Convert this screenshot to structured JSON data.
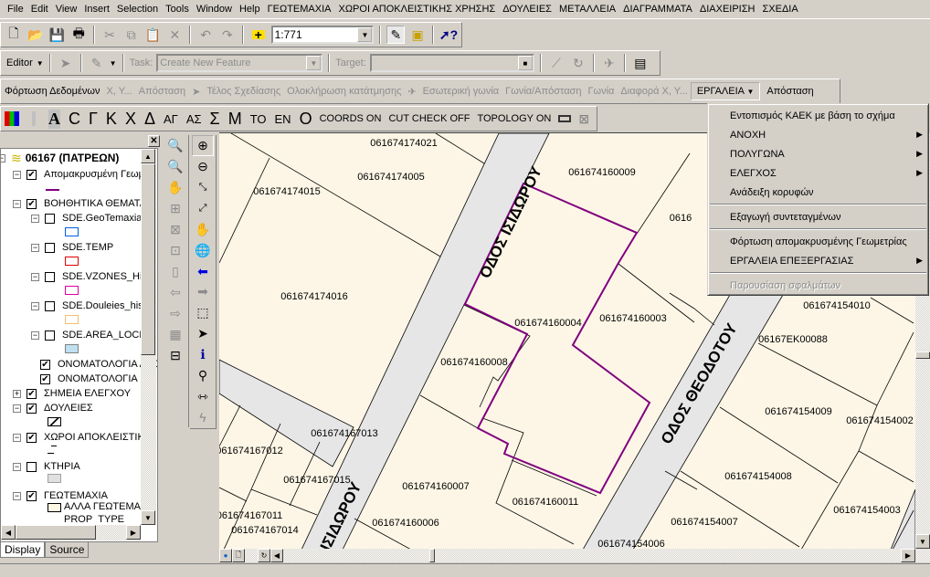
{
  "menubar": [
    "File",
    "Edit",
    "View",
    "Insert",
    "Selection",
    "Tools",
    "Window",
    "Help",
    "ΓΕΩΤΕΜΑΧΙΑ",
    "ΧΩΡΟΙ ΑΠΟΚΛΕΙΣΤΙΚΗΣ ΧΡΗΣΗΣ",
    "ΔΟΥΛΕΙΕΣ",
    "ΜΕΤΑΛΛΕΙΑ",
    "ΔΙΑΓΡΑΜΜΑΤΑ",
    "ΔΙΑΧΕΙΡΙΣΗ",
    "ΣΧΕΔΙΑ"
  ],
  "standard": {
    "scale": "1:771",
    "icons": [
      "new-document",
      "open-folder",
      "save",
      "print",
      "cut",
      "copy",
      "paste",
      "delete",
      "undo",
      "redo",
      "add-data",
      "editor-toolbar",
      "arccatalog",
      "whats-this"
    ]
  },
  "editor": {
    "label": "Editor",
    "task_label": "Task:",
    "task_value": "Create New Feature",
    "target_label": "Target:",
    "target_value": ""
  },
  "custom": {
    "items": [
      "Φόρτωση Δεδομένων",
      "X, Y...",
      "Απόσταση",
      "Τέλος Σχεδίασης",
      "Ολοκλήρωση κατάτμησης",
      "Εσωτερική γωνία",
      "Γωνία/Απόσταση",
      "Γωνία",
      "Διαφορά X, Y...",
      "ΕΡΓΑΛΕΙΑ",
      "Απόσταση"
    ]
  },
  "letters": {
    "items": [
      "A",
      "C",
      "Γ",
      "Κ",
      "Χ",
      "Δ",
      "ΑΓ",
      "ΑΣ",
      "Σ",
      "Μ",
      "ΤΟ",
      "ΕΝ",
      "Ο"
    ],
    "coords": "COORDS ON",
    "cut": "CUT CHECK OFF",
    "topology": "TOPOLOGY ON"
  },
  "toc": {
    "root": "06167 (ΠΑΤΡΕΩΝ)",
    "layers": [
      "Απομακρυσμένη Γεωμ",
      "ΒΟΗΘΗΤΙΚΑ ΘΕΜΑΤΑ",
      "SDE.GeoTemaxia",
      "SDE.TEMP",
      "SDE.VZONES_His",
      "SDE.Douleies_his",
      "SDE.AREA_LOCK",
      "ΟΝΟΜΑΤΟΛΟΓΙΑ ΔΡΟ",
      "ΟΝΟΜΑΤΟΛΟΓΙΑ",
      "ΣΗΜΕΙΑ ΕΛΕΓΧΟΥ",
      "ΔΟΥΛΕΙΕΣ",
      "ΧΩΡΟΙ ΑΠΟΚΛΕΙΣΤΙΚ",
      "ΚΤΗΡΙΑ",
      "ΓΕΩΤΕΜΑΧΙΑ",
      "ΑΛΛΑ ΓΕΩΤΕΜΑΧ",
      "PROP_TYPE"
    ],
    "checked": [
      true,
      true,
      false,
      false,
      false,
      false,
      false,
      true,
      true,
      true,
      true,
      true,
      false,
      true
    ],
    "swatch_colors": {
      "remote": "#800080",
      "geotemaxia": "#0060e0",
      "temp": "#e00000",
      "vzones": "#e000a0",
      "douleies": "#f0c070",
      "area_lock": "#bfe0f0",
      "ktiria": "#e0e0e0",
      "alla": "#fff8e6"
    },
    "tabs": [
      "Display",
      "Source"
    ]
  },
  "map": {
    "parcel_fill": "#fdf6e6",
    "road_fill": "#e6e6e6",
    "selection_color": "#800080",
    "labels": [
      "061674174021",
      "061674174005",
      "061674174015",
      "061674160009",
      "0616",
      "061674174016",
      "061674160004",
      "061674160003",
      "061674160008",
      "061674167013",
      "061674167012",
      "061674167015",
      "061674160007",
      "061674160011",
      "061674167011",
      "061674167014",
      "061674160006",
      "061674154006",
      "061674154010",
      "06167ΕΚ00088",
      "061674154009",
      "061674154002",
      "061674154008",
      "061674154003",
      "061674154007"
    ],
    "roads": [
      "ΟΔΟΣ ΙΣΙΔΩΡΟΥ",
      "ΙΣΙΔΩΡΟΥ",
      "ΟΔΟΣ ΘΕΟΔΟΤΟΥ"
    ]
  },
  "context_menu": [
    {
      "label": "Εντοπισμός ΚΑΕΚ με βάση το σχήμα",
      "submenu": false
    },
    {
      "label": "ΑΝΟΧΗ",
      "submenu": true
    },
    {
      "label": "ΠΟΛΥΓΩΝΑ",
      "submenu": true
    },
    {
      "label": "ΕΛΕΓΧΟΣ",
      "submenu": true
    },
    {
      "label": "Ανάδειξη κορυφών",
      "submenu": false
    },
    {
      "label": "Εξαγωγή συντεταγμένων",
      "submenu": false
    },
    {
      "label": "Φόρτωση απομακρυσμένης Γεωμετρίας",
      "submenu": false
    },
    {
      "label": "ΕΡΓΑΛΕΙΑ ΕΠΕΞΕΡΓΑΣΙΑΣ",
      "submenu": true
    },
    {
      "label": "Παρουσίαση σφαλμάτων",
      "submenu": false,
      "disabled": true
    }
  ]
}
